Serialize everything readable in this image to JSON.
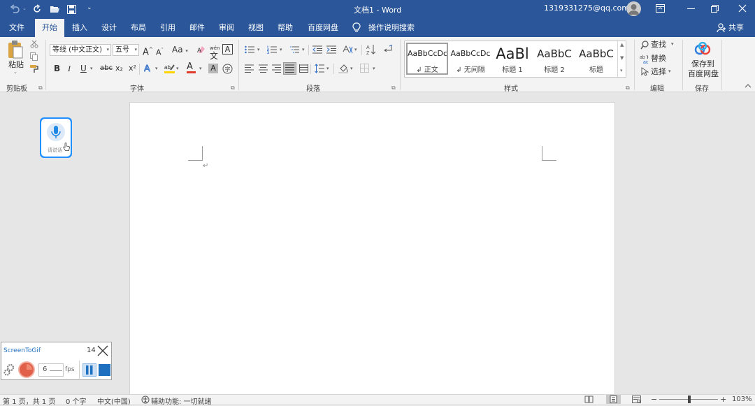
{
  "titlebar": {
    "doc_title": "文档1  -  Word",
    "account": "1319331275@qq.com"
  },
  "tabs": [
    "文件",
    "开始",
    "插入",
    "设计",
    "布局",
    "引用",
    "邮件",
    "审阅",
    "视图",
    "帮助",
    "百度网盘",
    "操作说明搜索"
  ],
  "share_label": "共享",
  "ribbon": {
    "clipboard": {
      "paste": "粘贴",
      "group": "剪贴板"
    },
    "font": {
      "name": "等线 (中文正文)",
      "size": "五号",
      "group": "字体",
      "bold": "B",
      "italic": "I",
      "underline": "U",
      "strike": "abc",
      "sub": "x₂",
      "sup": "x²",
      "aa": "Aa",
      "grow": "A",
      "shrink": "A",
      "wen": "文",
      "A_box": "A",
      "font_color": "A"
    },
    "paragraph": {
      "group": "段落"
    },
    "styles": {
      "group": "样式",
      "tiles": [
        {
          "preview": "AaBbCcDc",
          "name": "↲ 正文"
        },
        {
          "preview": "AaBbCcDc",
          "name": "↲ 无间隔"
        },
        {
          "preview": "AaBl",
          "name": "标题 1"
        },
        {
          "preview": "AaBbC",
          "name": "标题 2"
        },
        {
          "preview": "AaBbC",
          "name": "标题"
        }
      ]
    },
    "editing": {
      "find": "查找",
      "replace": "替换",
      "select": "选择",
      "group": "编辑"
    },
    "save": {
      "label1": "保存到",
      "label2": "百度网盘",
      "group": "保存"
    }
  },
  "voice_widget": {
    "label": "请说话"
  },
  "screentogif": {
    "title": "ScreenToGif",
    "frame_count": "14",
    "fps_value": "6",
    "fps_unit": "fps"
  },
  "statusbar": {
    "pages": "第 1 页，共 1 页",
    "words": "0 个字",
    "language": "中文(中国)",
    "accessibility": "辅助功能: 一切就绪",
    "zoom": "103%",
    "zoom_level": 0.515
  },
  "colors": {
    "accent": "#2b579a",
    "record": "#e0604a",
    "stop_blue": "#1e6fbf"
  }
}
